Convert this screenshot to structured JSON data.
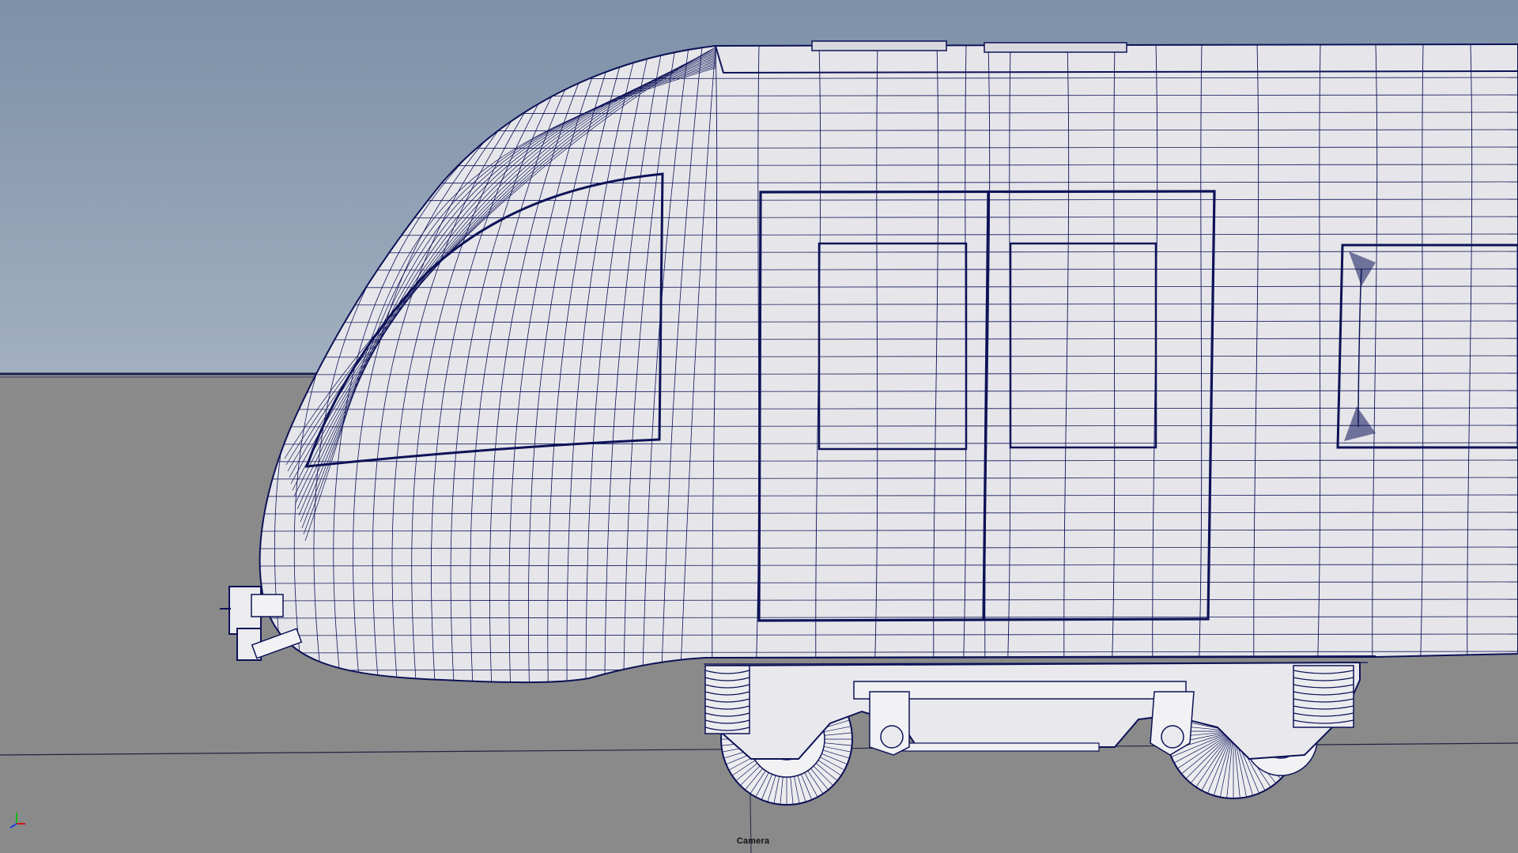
{
  "viewport": {
    "camera_label": "Camera",
    "axis_gizmo": {
      "x_color": "#d01818",
      "y_color": "#18b818",
      "z_color": "#2040e0"
    }
  },
  "colors": {
    "sky_top": "#7d90a8",
    "sky_bottom": "#a2b0c0",
    "ground": "#8a8a8a",
    "model_fill": "#e6e6ea",
    "wire": "#0d1257",
    "horizon": "#1a1f4a"
  },
  "model": {
    "name": "train-front-car",
    "display": "wireframe-on-shaded",
    "parts": [
      "nose",
      "windshield",
      "door",
      "door-window-left",
      "door-window-right",
      "side-window",
      "bogie",
      "coupler",
      "springs",
      "wheels"
    ]
  }
}
